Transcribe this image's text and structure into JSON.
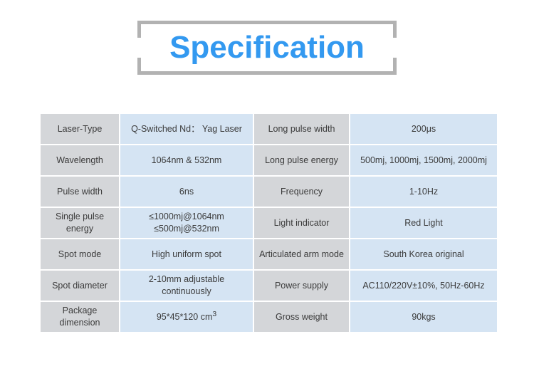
{
  "title": {
    "text": "Specification",
    "color": "#3399f0",
    "frame_color": "#b2b2b2"
  },
  "theme": {
    "label_cell_bg": "#d4d6d9",
    "value_cell_bg": "#d5e4f3",
    "text_color": "#3b3b3b",
    "page_bg": "#ffffff"
  },
  "spec_table": {
    "rows": [
      {
        "left_label": "Laser-Type",
        "left_value": "Q-Switched Nd： Yag Laser",
        "left_value_align": "left",
        "right_label": "Long pulse width",
        "right_value": "200μs"
      },
      {
        "left_label": "Wavelength",
        "left_value": "1064nm & 532nm",
        "right_label": "Long pulse energy",
        "right_value": "500mj, 1000mj, 1500mj, 2000mj"
      },
      {
        "left_label": "Pulse width",
        "left_value": "6ns",
        "right_label": "Frequency",
        "right_value": "1-10Hz"
      },
      {
        "left_label": "Single pulse energy",
        "left_value_line1": "≤1000mj@1064nm",
        "left_value_line2": "≤500mj@532nm",
        "right_label": "Light indicator",
        "right_value": "Red Light"
      },
      {
        "left_label": "Spot mode",
        "left_value": "High uniform spot",
        "right_label": "Articulated arm mode",
        "right_value": "South Korea original"
      },
      {
        "left_label": "Spot diameter",
        "left_value": "2-10mm adjustable continuously",
        "right_label": "Power supply",
        "right_value": "AC110/220V±10%,  50Hz-60Hz"
      },
      {
        "left_label": "Package dimension",
        "left_value_main": "95*45*120 cm",
        "left_value_sup": "3",
        "right_label": "Gross weight",
        "right_value": "90kgs"
      }
    ]
  }
}
